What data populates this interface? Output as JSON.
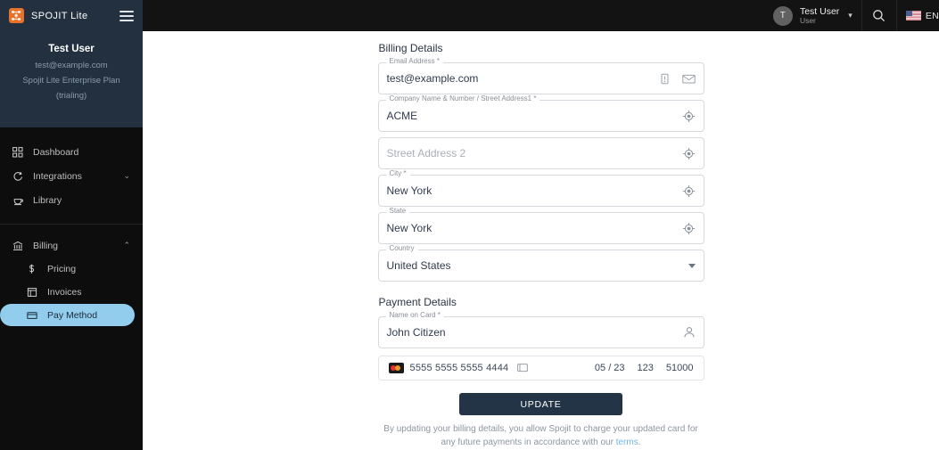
{
  "brand": {
    "name": "SPOJIT Lite",
    "logo_icon": "network-nodes-icon",
    "logo_color": "#e8722a",
    "menu_icon": "hamburger-menu-icon"
  },
  "topbar": {
    "background": "#131313",
    "avatar_initial": "T",
    "user_name": "Test User",
    "user_role": "User",
    "caret_icon": "chevron-down-icon",
    "search_icon": "search-icon",
    "flag_icon": "us-flag-icon",
    "language_label": "EN"
  },
  "sidebar": {
    "background": "#0d0d0d",
    "header_background": "#22303f",
    "active_color": "#92cdee",
    "user": {
      "name": "Test User",
      "email": "test@example.com",
      "plan": "Spojit Lite Enterprise Plan",
      "status": "(trialing)"
    },
    "items": [
      {
        "label": "Dashboard",
        "icon": "dashboard-grid-icon",
        "chevron": ""
      },
      {
        "label": "Integrations",
        "icon": "integrations-icon",
        "chevron": "⌄"
      },
      {
        "label": "Library",
        "icon": "library-icon",
        "chevron": ""
      }
    ],
    "billing": {
      "label": "Billing",
      "icon": "bank-icon",
      "chevron": "⌃",
      "sub_items": [
        {
          "label": "Pricing",
          "icon": "dollar-icon",
          "active": false
        },
        {
          "label": "Invoices",
          "icon": "invoice-icon",
          "active": false
        },
        {
          "label": "Pay Method",
          "icon": "credit-card-icon",
          "active": true
        }
      ]
    }
  },
  "main": {
    "billing_section_title": "Billing Details",
    "payment_section_title": "Payment Details",
    "fields": {
      "email": {
        "label": "Email Address *",
        "value": "test@example.com",
        "icons": [
          "alert-box-icon",
          "envelope-icon"
        ]
      },
      "company": {
        "label": "Company Name & Number / Street Address1 *",
        "value": "ACME",
        "icons": [
          "target-location-icon"
        ]
      },
      "street2": {
        "label": "",
        "placeholder": "Street Address 2",
        "value": "",
        "icons": [
          "target-location-icon"
        ]
      },
      "city": {
        "label": "City *",
        "value": "New York",
        "icons": [
          "target-location-icon"
        ]
      },
      "state": {
        "label": "State",
        "value": "New York",
        "icons": [
          "target-location-icon"
        ]
      },
      "country": {
        "label": "Country",
        "value": "United States",
        "icons": [
          "chevron-down-icon"
        ]
      },
      "name_on_card": {
        "label": "Name on Card *",
        "value": "John Citizen",
        "icons": [
          "person-icon"
        ]
      }
    },
    "card": {
      "brand_icon": "mastercard-icon",
      "number": "5555 5555 5555 4444",
      "card_glyph": "credit-card-icon",
      "expiry": "05 / 23",
      "cvc": "123",
      "zip": "51000"
    },
    "update_button": "UPDATE",
    "legal_text_part1": "By updating your billing details, you allow Spojit to charge your updated card for any future payments in accordance with our ",
    "legal_link": "terms",
    "legal_text_part2": "."
  }
}
